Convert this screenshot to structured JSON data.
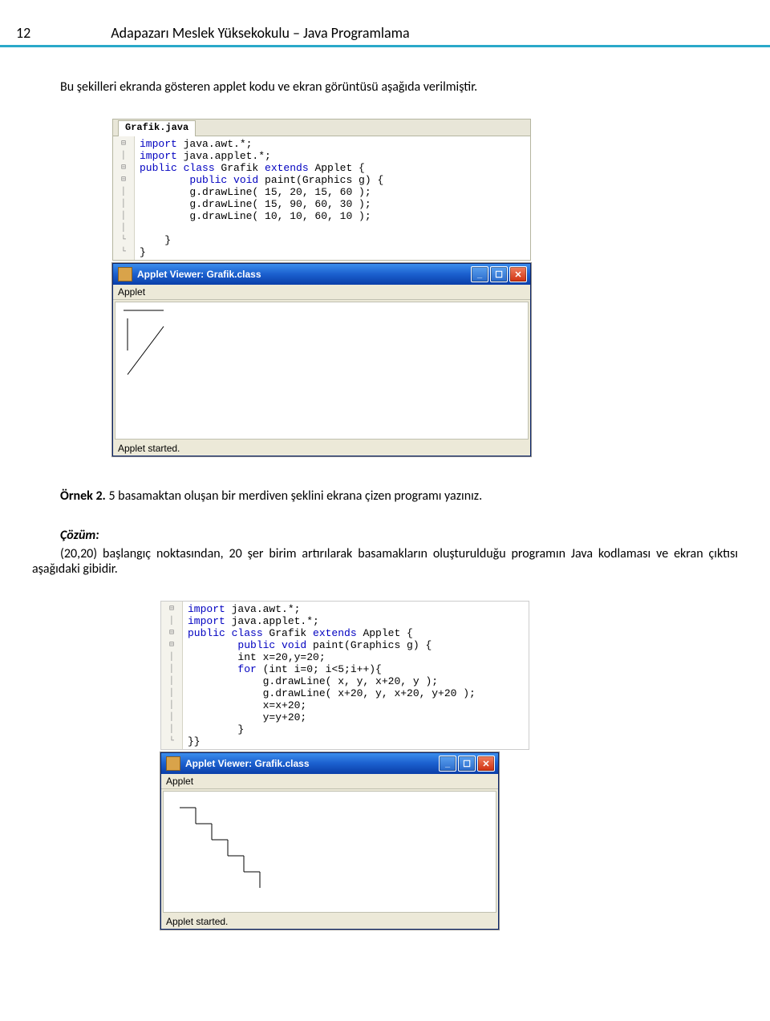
{
  "header": {
    "page_number": "12",
    "title": "Adapazarı Meslek Yüksekokulu – Java Programlama"
  },
  "intro_text": "Bu şekilleri ekranda gösteren applet kodu ve ekran görüntüsü aşağıda verilmiştir.",
  "editor1": {
    "tab": "Grafik.java",
    "lines": {
      "l1a": "import",
      "l1b": " java.awt.*;",
      "l2a": "import",
      "l2b": " java.applet.*;",
      "l3a": "public class ",
      "l3b": "Grafik ",
      "l3c": "extends",
      "l3d": " Applet {",
      "l4a": "        public void ",
      "l4b": "paint(Graphics g) {",
      "l5": "        g.drawLine( 15, 20, 15, 60 );",
      "l6": "        g.drawLine( 15, 90, 60, 30 );",
      "l7": "        g.drawLine( 10, 10, 60, 10 );",
      "l8": "",
      "l9": "    }",
      "l10": "}"
    }
  },
  "win1": {
    "title": "Applet Viewer: Grafik.class",
    "menu": "Applet",
    "status": "Applet started."
  },
  "example2": {
    "heading_label": "Örnek 2.",
    "heading_text": " 5 basamaktan oluşan bir merdiven şeklini ekrana çizen programı yazınız.",
    "solution_label": "Çözüm:",
    "solution_text": "(20,20) başlangıç noktasından, 20 şer birim artırılarak basamakların oluşturulduğu programın Java kodlaması ve ekran çıktısı aşağıdaki gibidir."
  },
  "editor2": {
    "lines": {
      "l1a": "import",
      "l1b": " java.awt.*;",
      "l2a": "import",
      "l2b": " java.applet.*;",
      "l3a": "public class ",
      "l3b": "Grafik ",
      "l3c": "extends",
      "l3d": " Applet {",
      "l4a": "        public void ",
      "l4b": "paint(Graphics g) {",
      "l5": "        int x=20,y=20;",
      "l6a": "        for",
      "l6b": " (int i=0; i<5;i++){",
      "l7": "            g.drawLine( x, y, x+20, y );",
      "l8": "            g.drawLine( x+20, y, x+20, y+20 );",
      "l9": "            x=x+20;",
      "l10": "            y=y+20;",
      "l11": "        }",
      "l12": "}}"
    }
  },
  "win2": {
    "title": "Applet Viewer: Grafik.class",
    "menu": "Applet",
    "status": "Applet started."
  }
}
